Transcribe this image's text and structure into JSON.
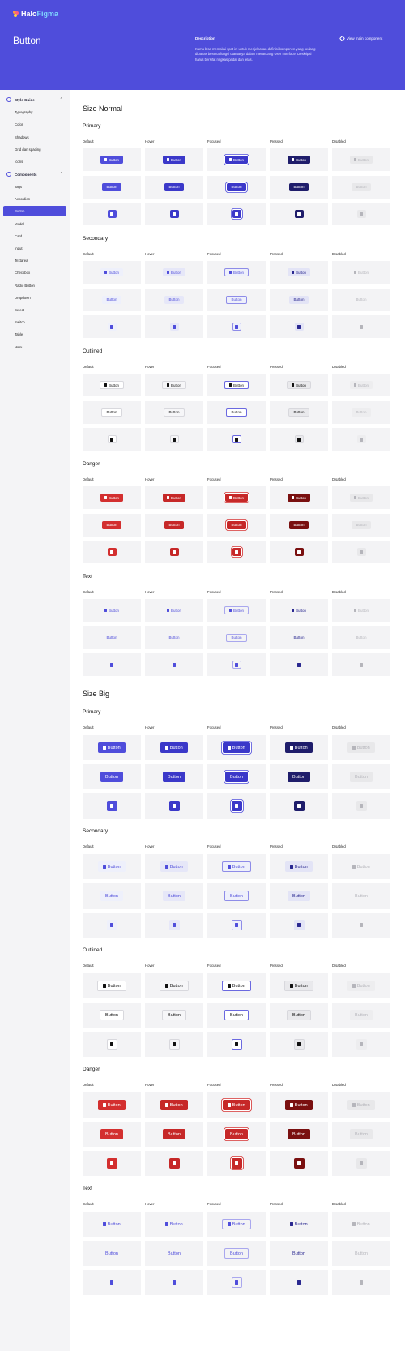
{
  "header": {
    "logo_part1": "Halo",
    "logo_part2": "Figma",
    "title": "Button",
    "description_heading": "Description",
    "description_body": "Kamu bisa memakai spot ini untuk menjelaskan definisi komponen yang sedang dibahas beserta fungsi utamanya dalam merancang User Interface. Deskripsi harus bersifat ringkas padat dan jelas.",
    "main_component_link": "View main component"
  },
  "sidebar": {
    "group1": "Style Guide",
    "group1_items": [
      "Typography",
      "Color",
      "Shadows",
      "Grid dan spacing",
      "Icons"
    ],
    "group2": "Components",
    "group2_items": [
      "Tags",
      "Accordion",
      "Button",
      "Modal",
      "Card",
      "Input",
      "Textarea",
      "Checkbox",
      "Radio Button",
      "Dropdown",
      "Select",
      "Switch",
      "Table",
      "Menu"
    ],
    "active_item": "Button"
  },
  "sections": [
    {
      "title": "Size Normal",
      "size": "normal"
    },
    {
      "title": "Size Big",
      "size": "big"
    }
  ],
  "states": [
    "Default",
    "Hover",
    "Focused",
    "Pressed",
    "Disabled"
  ],
  "button_label": "Button",
  "variants": [
    {
      "name": "Primary",
      "key": "primary"
    },
    {
      "name": "Secondary",
      "key": "secondary"
    },
    {
      "name": "Outlined",
      "key": "outlined"
    },
    {
      "name": "Danger",
      "key": "danger"
    },
    {
      "name": "Text",
      "key": "text"
    }
  ],
  "colors": {
    "brand": "#4f4ddb",
    "primary_default": "#4f4ddb",
    "primary_hover": "#3b38c9",
    "primary_pressed": "#1f1d6b",
    "danger_default": "#d32f2f",
    "danger_hover": "#c62828",
    "danger_pressed": "#7a1010",
    "disabled_bg": "#e8e8ea",
    "disabled_fg": "#b5b5bb"
  }
}
